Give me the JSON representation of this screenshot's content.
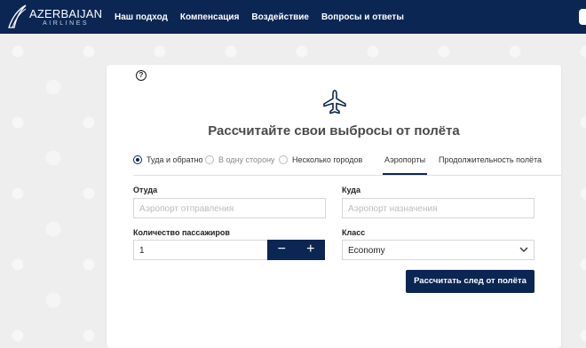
{
  "brand": {
    "logo_main": "AZERBAIJAN",
    "logo_sub": "AIRLINES",
    "navy": "#0b2653"
  },
  "nav": {
    "items": [
      {
        "label": "Наш подход"
      },
      {
        "label": "Компенсация"
      },
      {
        "label": "Воздействие"
      },
      {
        "label": "Вопросы и ответы"
      }
    ]
  },
  "calculator": {
    "title": "Рассчитайте свои выбросы от полёта",
    "trip_options": [
      {
        "label": "Туда и обратно",
        "selected": true
      },
      {
        "label": "В одну сторону",
        "selected": false
      },
      {
        "label": "Несколько городов",
        "selected": false
      }
    ],
    "tabs": [
      {
        "label": "Аэропорты",
        "active": true
      },
      {
        "label": "Продолжительность полёта",
        "active": false
      }
    ],
    "from": {
      "label": "Отуда",
      "placeholder": "Аэропорт отправления"
    },
    "to": {
      "label": "Куда",
      "placeholder": "Аэропорт назначения"
    },
    "passengers": {
      "label": "Количество пассажиров",
      "value": "1",
      "minus": "−",
      "plus": "+"
    },
    "class": {
      "label": "Класс",
      "value": "Economy"
    },
    "submit_label": "Рассчитать след от полёта",
    "help_glyph": "?"
  }
}
